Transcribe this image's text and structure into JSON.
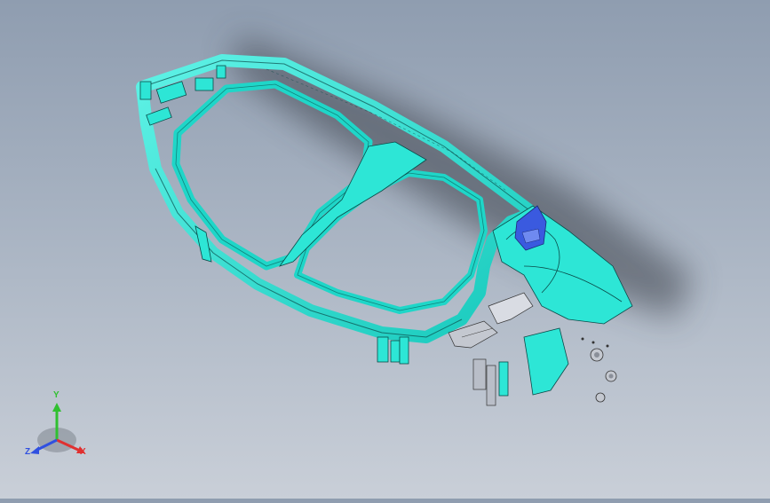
{
  "viewport": {
    "model_name": "",
    "colors": {
      "frame": "#2de6d6",
      "frame_edge": "#0a4a48",
      "bracket_blue": "#3a5adf",
      "plate_grey": "#c4c8d0",
      "shadow": "#3a3f49"
    }
  },
  "triad": {
    "x_label": "X",
    "y_label": "Y",
    "z_label": "Z",
    "x_color": "#e03030",
    "y_color": "#30c030",
    "z_color": "#3050e0"
  }
}
